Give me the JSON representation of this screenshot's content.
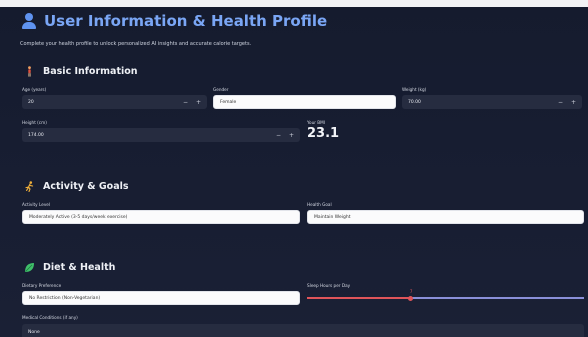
{
  "page": {
    "title": "User Information & Health Profile",
    "subtitle": "Complete your health profile to unlock personalized AI insights and accurate calorie targets."
  },
  "sections": {
    "basic": "Basic Information",
    "activity": "Activity & Goals",
    "diet": "Diet & Health"
  },
  "fields": {
    "age": {
      "label": "Age (years)",
      "value": "20"
    },
    "gender": {
      "label": "Gender",
      "value": "Female"
    },
    "weight": {
      "label": "Weight (kg)",
      "value": "70.00"
    },
    "height": {
      "label": "Height (cm)",
      "value": "174.00"
    },
    "bmi": {
      "label": "Your BMI",
      "value": "23.1"
    },
    "activity_level": {
      "label": "Activity Level",
      "value": "Moderately Active (3-5 days/week exercise)"
    },
    "health_goal": {
      "label": "Health Goal",
      "value": "Maintain Weight"
    },
    "dietary_preference": {
      "label": "Dietary Preference",
      "value": "No Restriction (Non-Vegetarian)"
    },
    "sleep_hours": {
      "label": "Sleep Hours per Day",
      "value": 7,
      "min": 4,
      "max": 12
    },
    "medical_conditions": {
      "label": "Medical Conditions (if any)",
      "value": "None"
    }
  },
  "stepper": {
    "minus": "−",
    "plus": "+"
  },
  "colors": {
    "accent": "#7aa6f5",
    "slider": "#e0555a",
    "slider_rest": "#8a8fd8"
  },
  "icons": {
    "title": "person-icon",
    "basic": "standing-person-icon",
    "activity": "running-person-icon",
    "diet": "leaf-icon"
  }
}
